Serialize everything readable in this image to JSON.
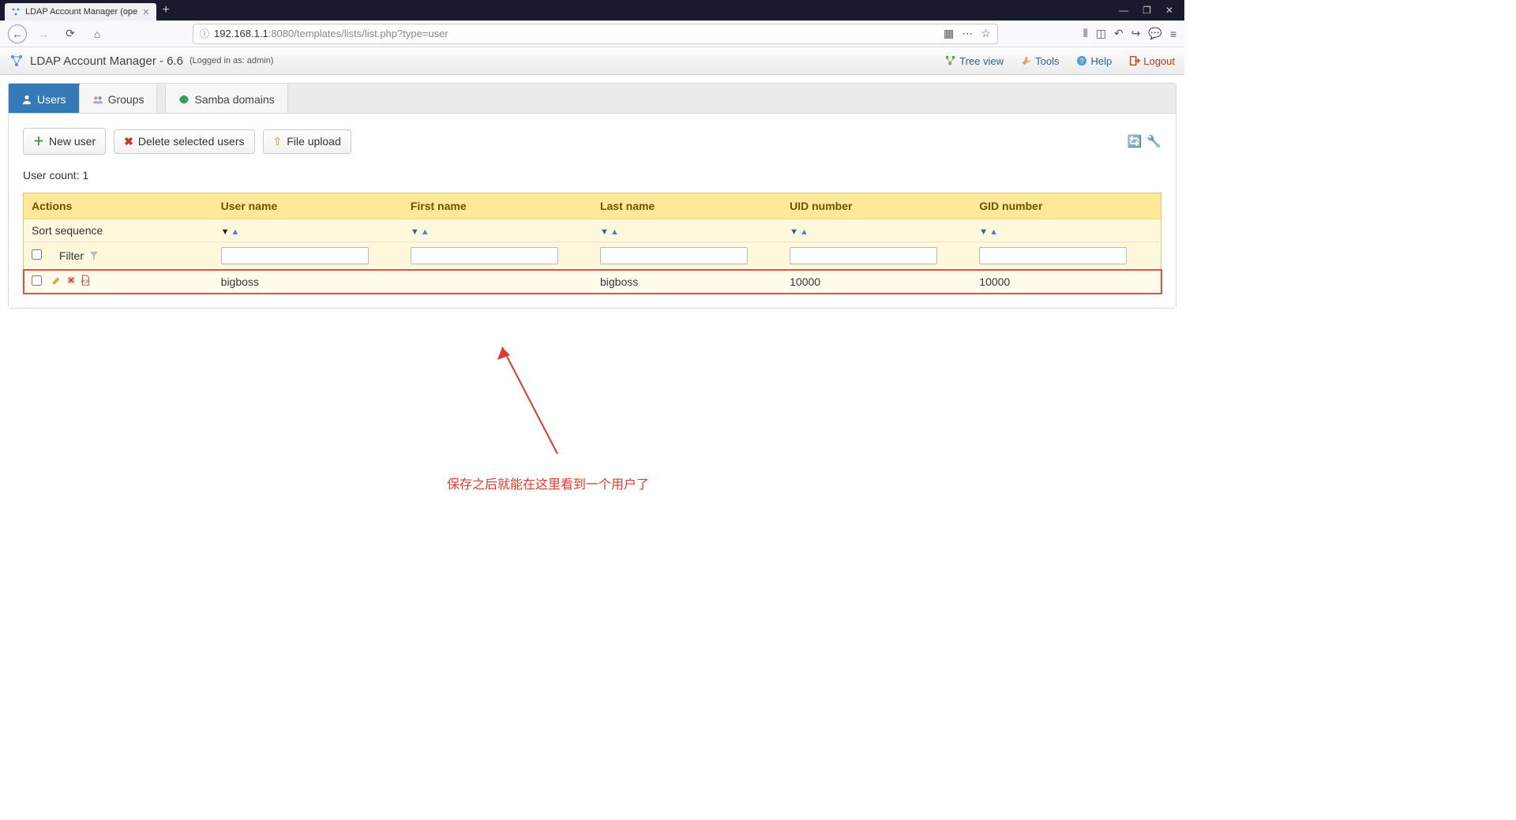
{
  "browser": {
    "tab_title": "LDAP Account Manager (ope",
    "url_host": "192.168.1.1",
    "url_port_path": ":8080/templates/lists/list.php?type=user"
  },
  "header": {
    "app_title": "LDAP Account Manager - 6.6",
    "logged_in": "(Logged in as: admin)",
    "links": {
      "tree_view": "Tree view",
      "tools": "Tools",
      "help": "Help",
      "logout": "Logout"
    }
  },
  "tabs": {
    "users": "Users",
    "groups": "Groups",
    "samba": "Samba domains"
  },
  "toolbar": {
    "new_user": "New user",
    "delete_selected": "Delete selected users",
    "file_upload": "File upload"
  },
  "count": {
    "label": "User count:",
    "value": "1"
  },
  "table": {
    "headers": {
      "actions": "Actions",
      "username": "User name",
      "firstname": "First name",
      "lastname": "Last name",
      "uid": "UID number",
      "gid": "GID number"
    },
    "sort_label": "Sort sequence",
    "filter_label": "Filter",
    "rows": [
      {
        "username": "bigboss",
        "firstname": "",
        "lastname": "bigboss",
        "uid": "10000",
        "gid": "10000"
      }
    ]
  },
  "annotation": {
    "text": "保存之后就能在这里看到一个用户了"
  }
}
